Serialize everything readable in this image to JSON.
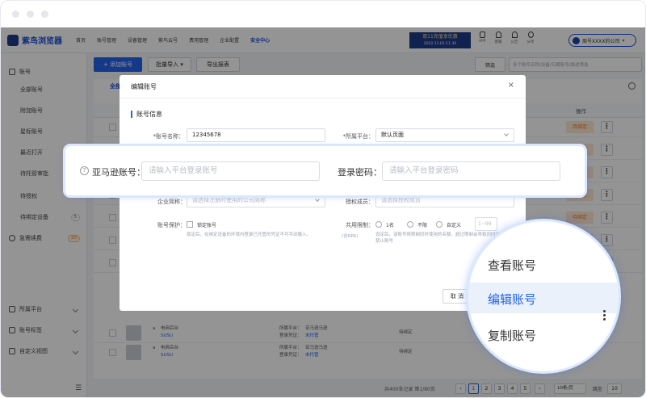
{
  "app": {
    "name": "紫鸟浏览器"
  },
  "nav": {
    "items": [
      "首页",
      "账号管理",
      "设备管理",
      "紫鸟云号",
      "费用管理",
      "企业配置",
      "安全中心"
    ]
  },
  "promo": {
    "line1": "双11充值享优惠",
    "line2": "2022.11.01-11.30"
  },
  "top_icons": [
    {
      "icon": "phone-icon",
      "label": "APP"
    },
    {
      "icon": "headset-icon",
      "label": "客服"
    },
    {
      "icon": "bell-icon",
      "label": "公告"
    },
    {
      "icon": "upload-icon",
      "label": "分享"
    }
  ],
  "user": {
    "label": "周号XXXX的公司"
  },
  "sidebar": {
    "header": "账号",
    "items": [
      "全部账号",
      "附加账号",
      "星标账号",
      "最近打开",
      "待托管审批",
      "待授权",
      "待绑定设备"
    ],
    "badge_bind": "5",
    "renew": "急需续费",
    "badge_renew": "20",
    "bottom": [
      "所属平台",
      "账号标签",
      "自定义视图"
    ]
  },
  "toolbar": {
    "add": "+ 添加账号",
    "batch": "批量导入 ▾",
    "export": "导出报表",
    "filter": "筛选",
    "search_placeholder": "多个账号名称/设备/归属账号/描述筛选"
  },
  "table": {
    "tab": "全部",
    "action_header": "操作",
    "bind_label": "待绑定",
    "bind_label2": "待绑定"
  },
  "rows": [
    {
      "platform": "电商后台",
      "owner": "SUSU",
      "plat_label": "所属平台：",
      "plat_val": "亚马逊马逊",
      "cred_label": "登录凭证：",
      "cred_val": "未托管",
      "status": "待绑定"
    },
    {
      "platform": "电商后台",
      "owner": "SUSU",
      "plat_label": "所属平台：",
      "plat_val": "亚马逊马逊",
      "cred_label": "登录凭证：",
      "cred_val": "未托管",
      "status": "待绑定"
    }
  ],
  "pager": {
    "total": "共400条记录 第1/80页",
    "pages": [
      "1",
      "2",
      "3",
      "4",
      "5"
    ],
    "size": "10条/页",
    "jump": "跳至",
    "jump_val": "10"
  },
  "modal": {
    "title": "编辑账号",
    "close": "×",
    "section": "账号信息",
    "name_label": "*账号名称：",
    "name_value": "12345678",
    "platform_label": "*所属平台：",
    "platform_value": "默认页面",
    "company_label": "企业简称：",
    "company_placeholder": "请选择注册时使用的公司简称",
    "auth_label": "授权成员：",
    "auth_placeholder": "请选择授权成员",
    "protect_label": "账号保护：",
    "protect_option": "锁定账号",
    "protect_hint": "锁定后，在绑定设备的环境内登录已托管的凭证不可手动输入。",
    "login_limit_label": "共用限制：",
    "login_limit_sub": "(含RPA)",
    "limit_opts": [
      "1名",
      "不限",
      "自定义"
    ],
    "limit_range": "1~99",
    "limit_hint": "设定后，该账号将限制同时使用的名额，超过限制会导致同时访问被禁止账号",
    "cancel": "取 消"
  },
  "highlight": {
    "amazon_label": "亚马逊账号：",
    "amazon_placeholder": "请输入平台登录账号",
    "pwd_label": "登录密码：",
    "pwd_placeholder": "请输入平台登录密码"
  },
  "zoom_menu": {
    "items": [
      "查看账号",
      "编辑账号",
      "复制账号"
    ]
  }
}
